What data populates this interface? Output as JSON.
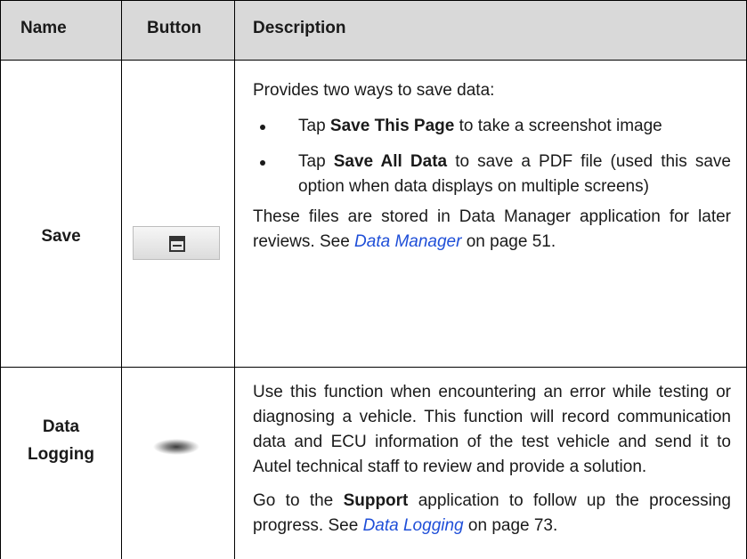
{
  "headers": {
    "name": "Name",
    "button": "Button",
    "description": "Description"
  },
  "rows": [
    {
      "name": "Save",
      "button_icon": "floppy-disk-icon",
      "intro": "Provides two ways to save data:",
      "bullet1": {
        "pre": "Tap ",
        "bold": "Save This Page",
        "post": " to take a screenshot image"
      },
      "bullet2": {
        "pre": "Tap ",
        "bold": "Save All Data",
        "post": " to save a PDF file (used this save option when data displays on multiple screens)"
      },
      "outro": "These files are stored in Data Manager application for later reviews. See ",
      "link": "Data Manager",
      "page_ref": " on page 51."
    },
    {
      "name_line1": "Data",
      "name_line2": "Logging",
      "button_icon": "data-logging-icon",
      "para1": "Use this function when encountering an error while testing or diagnosing a vehicle. This function will record communication data and ECU information of the test vehicle and send it to Autel technical staff to review and provide a solution.",
      "para2_pre": "Go to the ",
      "para2_bold": "Support",
      "para2_post": " application to follow up the processing progress. See ",
      "link": "Data Logging",
      "page_ref": " on page 73."
    }
  ],
  "colors": {
    "header_bg": "#d9d9d9",
    "link": "#1f4fd8",
    "border": "#000000"
  }
}
